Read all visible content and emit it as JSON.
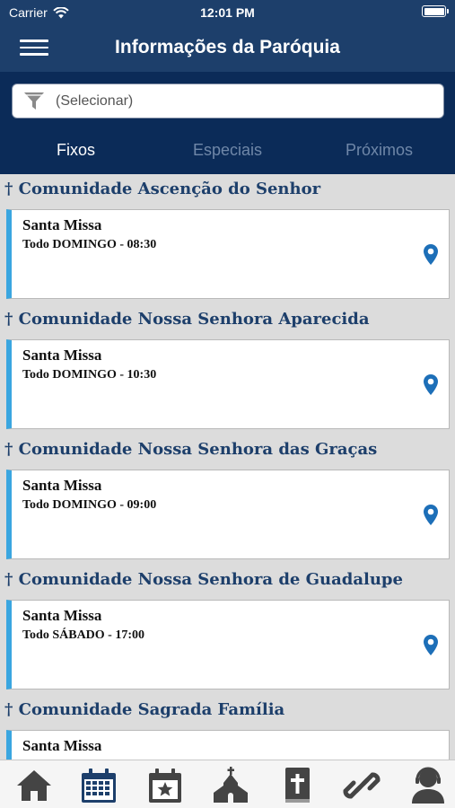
{
  "status_bar": {
    "carrier": "Carrier",
    "time": "12:01 PM"
  },
  "nav": {
    "title": "Informações da Paróquia",
    "menu_icon": "hamburger-menu-icon"
  },
  "filter": {
    "placeholder": "(Selecionar)",
    "icon": "filter-funnel-icon"
  },
  "tabs": [
    {
      "label": "Fixos",
      "active": true
    },
    {
      "label": "Especiais",
      "active": false
    },
    {
      "label": "Próximos",
      "active": false
    }
  ],
  "sections": [
    {
      "title": "† Comunidade Ascenção do Senhor",
      "event": {
        "title": "Santa Missa",
        "schedule": "Todo DOMINGO - 08:30"
      }
    },
    {
      "title": "† Comunidade Nossa Senhora Aparecida",
      "event": {
        "title": "Santa Missa",
        "schedule": "Todo DOMINGO - 10:30"
      }
    },
    {
      "title": "† Comunidade Nossa Senhora das Graças",
      "event": {
        "title": "Santa Missa",
        "schedule": "Todo DOMINGO - 09:00"
      }
    },
    {
      "title": "† Comunidade Nossa Senhora de Guadalupe",
      "event": {
        "title": "Santa Missa",
        "schedule": "Todo SÁBADO - 17:00"
      }
    },
    {
      "title": "† Comunidade Sagrada Família",
      "event": {
        "title": "Santa Missa",
        "schedule": ""
      }
    }
  ],
  "bottom_tabs": [
    "home-icon",
    "calendar-icon",
    "events-calendar-icon",
    "church-icon",
    "bible-icon",
    "link-icon",
    "contact-person-icon"
  ],
  "colors": {
    "header": "#1d3f6b",
    "header_dark": "#0b2b58",
    "accent": "#3aa6e0",
    "pin": "#1d6fb8",
    "tab_active": "#1d3f6b",
    "tab_inactive": "#444444"
  }
}
